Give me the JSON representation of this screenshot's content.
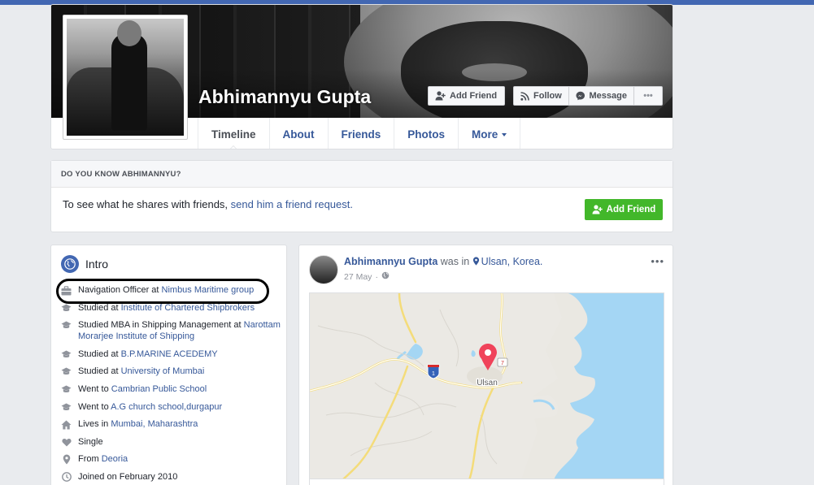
{
  "profile": {
    "name": "Abhimannyu Gupta"
  },
  "cover_actions": {
    "add_friend": "Add Friend",
    "follow": "Follow",
    "message": "Message",
    "more": "•••"
  },
  "tabs": [
    {
      "label": "Timeline",
      "active": true
    },
    {
      "label": "About"
    },
    {
      "label": "Friends"
    },
    {
      "label": "Photos"
    },
    {
      "label": "More"
    }
  ],
  "know_card": {
    "header": "DO YOU KNOW ABHIMANNYU?",
    "text_prefix": "To see what he shares with friends, ",
    "link": "send him a friend request.",
    "button": "Add Friend"
  },
  "intro": {
    "title": "Intro",
    "items": [
      {
        "icon": "briefcase-icon",
        "prefix": "Navigation Officer at ",
        "link": "Nimbus Maritime group"
      },
      {
        "icon": "graduation-cap-icon",
        "prefix": "Studied at ",
        "link": "Institute of Chartered Shipbrokers"
      },
      {
        "icon": "graduation-cap-icon",
        "prefix": "Studied MBA in Shipping Management at ",
        "link": "Narottam Morarjee Institute of Shipping"
      },
      {
        "icon": "graduation-cap-icon",
        "prefix": "Studied at ",
        "link": "B.P.MARINE ACEDEMY"
      },
      {
        "icon": "graduation-cap-icon",
        "prefix": "Studied at ",
        "link": "University of Mumbai"
      },
      {
        "icon": "graduation-cap-icon",
        "prefix": "Went to ",
        "link": "Cambrian Public School"
      },
      {
        "icon": "graduation-cap-icon",
        "prefix": "Went to ",
        "link": "A.G church school,durgapur"
      },
      {
        "icon": "home-icon",
        "prefix": "Lives in ",
        "link": "Mumbai, Maharashtra"
      },
      {
        "icon": "heart-icon",
        "prefix": "Single",
        "link": ""
      },
      {
        "icon": "location-pin-icon",
        "prefix": "From ",
        "link": "Deoria"
      },
      {
        "icon": "clock-icon",
        "prefix": "Joined on February 2010",
        "link": ""
      }
    ]
  },
  "post": {
    "author": "Abhimannyu Gupta",
    "verb": " was in ",
    "place": "Ulsan, Korea.",
    "date": "27 May",
    "more": "•••",
    "map": {
      "city_label": "Ulsan",
      "highway_label": "1",
      "road_label": "7"
    }
  },
  "colors": {
    "fb_blue": "#4267b2",
    "link": "#365899",
    "green": "#42b72a",
    "pin": "#f0435a",
    "sea": "#a4d6f4"
  }
}
